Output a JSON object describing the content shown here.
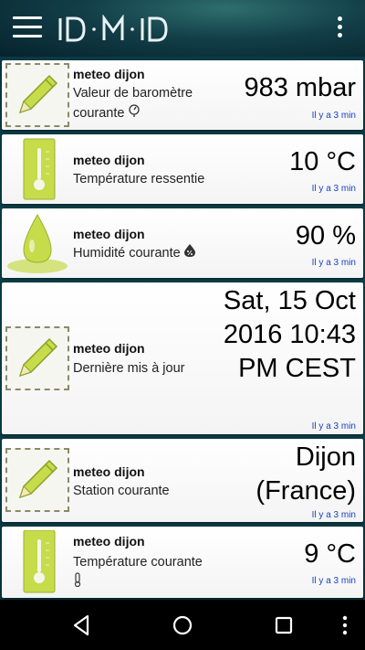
{
  "app": {
    "logo": "ID·M·ID"
  },
  "cards": [
    {
      "device": "meteo dijon",
      "description": "Valeur de baromètre courante",
      "value": "983 mbar",
      "time": "Il y a 3 min",
      "icon": "pencil-icon"
    },
    {
      "device": "meteo dijon",
      "description": "Température ressentie",
      "value": "10 °C",
      "time": "Il y a 3 min",
      "icon": "thermometer-icon"
    },
    {
      "device": "meteo dijon",
      "description": "Humidité courante",
      "value": "90 %",
      "time": "Il y a 3 min",
      "icon": "water-drop-icon"
    },
    {
      "device": "meteo dijon",
      "description": "Dernière mis à jour",
      "value": "Sat, 15 Oct 2016 10:43 PM CEST",
      "time": "Il y a 3 min",
      "icon": "pencil-icon"
    },
    {
      "device": "meteo dijon",
      "description": "Station courante",
      "value": "Dijon (France)",
      "time": "Il y a 3 min",
      "icon": "pencil-icon"
    },
    {
      "device": "meteo dijon",
      "description": "Température courante",
      "value": "9 °C",
      "time": "Il y a 3 min",
      "icon": "thermometer-icon"
    }
  ],
  "colors": {
    "appbar": "#123e48",
    "time_text": "#1a3fc4",
    "accent_green": "#c6dc4a"
  }
}
